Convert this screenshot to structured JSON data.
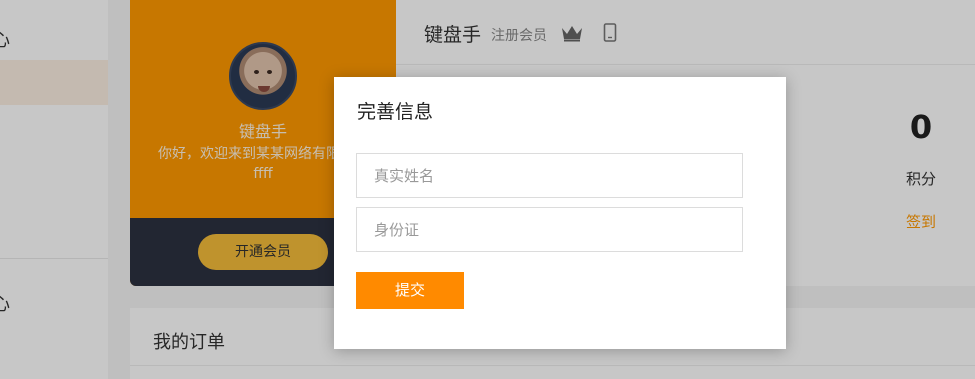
{
  "sidebar": {
    "section1_char": "心",
    "section2_char": "心"
  },
  "profile": {
    "username": "键盘手",
    "welcome": "你好，欢迎来到某某网络有限公司ffff",
    "vip_button": "开通会员"
  },
  "header": {
    "username": "键盘手",
    "member_level": "注册会员",
    "icons": [
      "crown-icon",
      "phone-icon"
    ]
  },
  "stats": {
    "points_value": "0",
    "points_label": "积分",
    "checkin_label": "签到"
  },
  "orders": {
    "title": "我的订单"
  },
  "modal": {
    "title": "完善信息",
    "name_placeholder": "真实姓名",
    "id_placeholder": "身份证",
    "submit_label": "提交"
  },
  "colors": {
    "brand_orange": "#ff9900",
    "submit_orange": "#ff8a00",
    "card_dark": "#2c3140",
    "vip_gold": "#f5bd3a"
  }
}
